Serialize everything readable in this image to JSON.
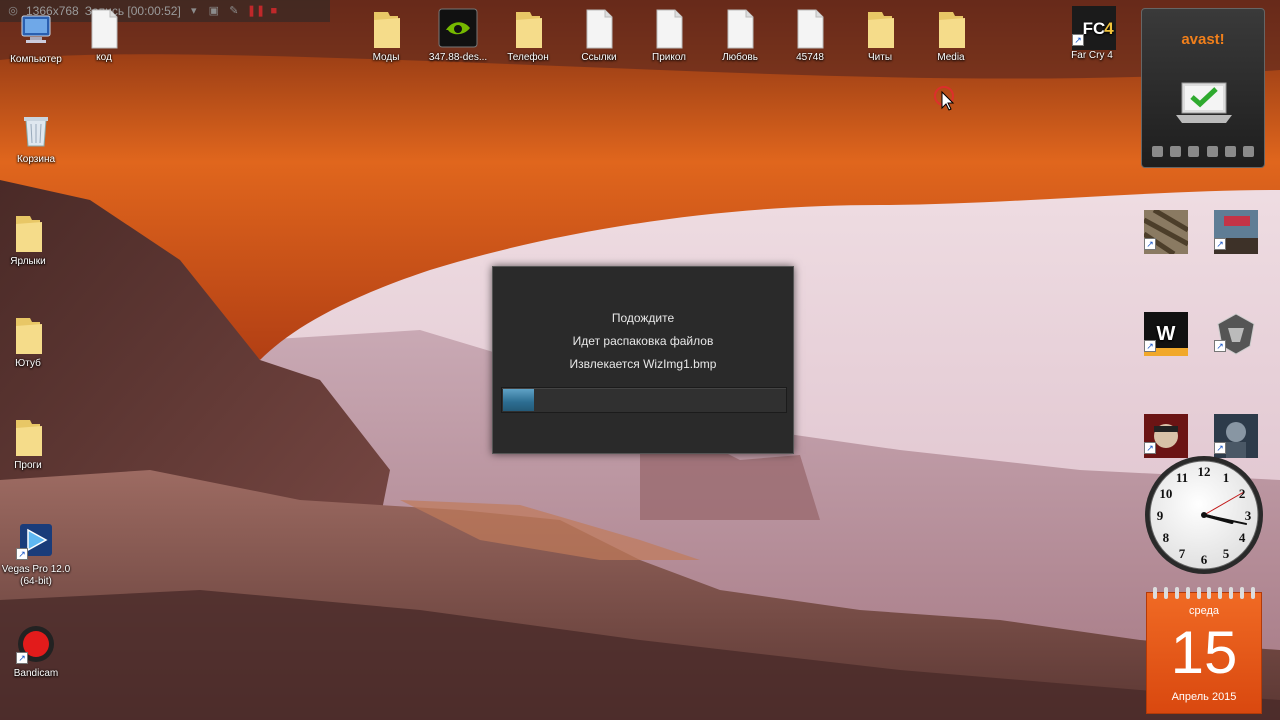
{
  "recorder": {
    "resolution": "1366x768",
    "status": "Запись [00:00:52]"
  },
  "desktop_left": [
    {
      "label": "Компьютер"
    },
    {
      "label": "Корзина"
    },
    {
      "label": "Ярлыки"
    },
    {
      "label": "Ютуб"
    },
    {
      "label": "Проги"
    },
    {
      "label": "Vegas Pro 12.0 (64-bit)"
    },
    {
      "label": "Bandicam"
    }
  ],
  "desktop_top": [
    {
      "label": "код"
    },
    {
      "label": "Моды"
    },
    {
      "label": "347.88-des..."
    },
    {
      "label": "Телефон"
    },
    {
      "label": "Ссылки"
    },
    {
      "label": "Прикол"
    },
    {
      "label": "Любовь"
    },
    {
      "label": "45748"
    },
    {
      "label": "Читы"
    },
    {
      "label": "Media"
    },
    {
      "label": "Far Cry 4"
    }
  ],
  "desktop_right_games": [
    {
      "label": ""
    },
    {
      "label": ""
    },
    {
      "label": ""
    },
    {
      "label": ""
    },
    {
      "label": ""
    },
    {
      "label": ""
    }
  ],
  "dialog": {
    "line1": "Подождите",
    "line2": "Идет распаковка файлов",
    "line3": "Извлекается WizImg1.bmp",
    "progress": 0.11
  },
  "avast": {
    "brand": "avast!",
    "status_icon": "laptop-check-icon"
  },
  "clock": {
    "numbers": [
      "12",
      "1",
      "2",
      "3",
      "4",
      "5",
      "6",
      "7",
      "8",
      "9",
      "10",
      "11"
    ],
    "hour": 3.5,
    "minute": 17,
    "second": 10
  },
  "calendar": {
    "day_of_week": "среда",
    "day": "15",
    "month_year": "Апрель 2015"
  },
  "colors": {
    "accent_avast": "#f07f1b",
    "calendar_orange": "#e85a1a",
    "progress_blue": "#3b84ad",
    "dialog_bg": "#2a2a2a"
  }
}
